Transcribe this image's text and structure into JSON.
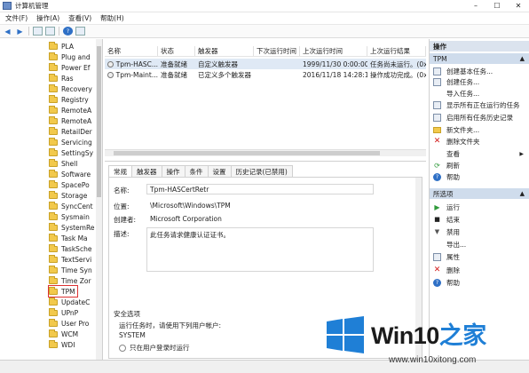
{
  "window": {
    "title": "计算机管理"
  },
  "menu": [
    "文件(F)",
    "操作(A)",
    "查看(V)",
    "帮助(H)"
  ],
  "tree": {
    "items": [
      "PLA",
      "Plug and",
      "Power Ef",
      "Ras",
      "Recovery",
      "Registry",
      "RemoteA",
      "RemoteA",
      "RetailDer",
      "Servicing",
      "SettingSy",
      "Shell",
      "Software",
      "SpacePo",
      "Storage",
      "SyncCent",
      "Sysmain",
      "SystemRe",
      "Task Ma",
      "TaskSche",
      "TextServi",
      "Time Syn",
      "Time Zor",
      "TPM",
      "UpdateC",
      "UPnP",
      "User Pro",
      "WCM",
      "WDI"
    ],
    "selected": "TPM"
  },
  "tasklist": {
    "columns": [
      "名称",
      "状态",
      "触发器",
      "下次运行时间",
      "上次运行时间",
      "上次运行结果"
    ],
    "rows": [
      [
        "Tpm-HASC...",
        "准备就绪",
        "自定义触发器",
        "",
        "1999/11/30 0:00:00",
        "任务尚未运行。(0x..."
      ],
      [
        "Tpm-Maint...",
        "准备就绪",
        "已定义多个触发器",
        "",
        "2016/11/18 14:28:19",
        "操作成功完成。(0x..."
      ]
    ]
  },
  "details": {
    "tabs": [
      "常规",
      "触发器",
      "操作",
      "条件",
      "设置",
      "历史记录(已禁用)"
    ],
    "name_label": "名称:",
    "name_value": "Tpm-HASCertRetr",
    "location_label": "位置:",
    "location_value": "\\Microsoft\\Windows\\TPM",
    "author_label": "创建者:",
    "author_value": "Microsoft Corporation",
    "desc_label": "描述:",
    "desc_value": "此任务请求健康认证证书。",
    "security_title": "安全选项",
    "run_as_label": "运行任务时，请使用下列用户帐户:",
    "run_as_value": "SYSTEM",
    "option1": "只在用户登录时运行"
  },
  "actions": {
    "header": "操作",
    "group1": "TPM",
    "group1_items": [
      "创建基本任务...",
      "创建任务...",
      "导入任务...",
      "显示所有正在运行的任务",
      "启用所有任务历史记录",
      "新文件夹...",
      "删除文件夹",
      "查看",
      "刷新",
      "帮助"
    ],
    "group2": "所选项",
    "group2_items": [
      "运行",
      "结束",
      "禁用",
      "导出...",
      "属性",
      "删除",
      "帮助"
    ]
  },
  "watermark": {
    "brand_prefix": "Win10",
    "brand_suffix": "之家",
    "url": "www.win10xitong.com"
  }
}
